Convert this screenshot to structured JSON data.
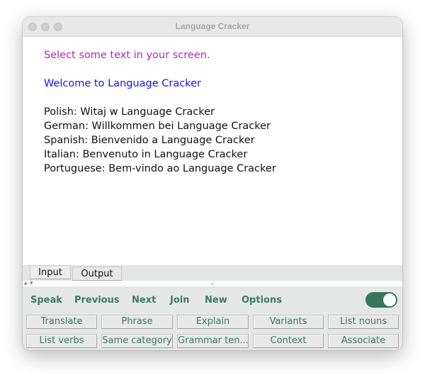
{
  "window": {
    "title": "Language Cracker",
    "traffic_lights": [
      "close",
      "minimize",
      "zoom"
    ]
  },
  "content": {
    "prompt": "Select some text in your screen.",
    "welcome": "Welcome to Language Cracker",
    "translations": [
      "Polish: Witaj w Language Cracker",
      "German: Willkommen bei Language Cracker",
      "Spanish: Bienvenido a Language Cracker",
      "Italian: Benvenuto in Language Cracker",
      "Portuguese: Bem-vindo ao Language Cracker"
    ],
    "colors": {
      "prompt": "#b126bd",
      "welcome": "#1414e6",
      "text": "#111111"
    }
  },
  "tabs": [
    {
      "label": "Input",
      "selected": true
    },
    {
      "label": "Output",
      "selected": false
    }
  ],
  "splitter": {
    "up_icon": "triangle-up-icon",
    "down_icon": "triangle-down-icon"
  },
  "actions": [
    {
      "label": "Speak"
    },
    {
      "label": "Previous"
    },
    {
      "label": "Next"
    },
    {
      "label": "Join"
    },
    {
      "label": "New"
    },
    {
      "label": "Options"
    }
  ],
  "toggle": {
    "on": true,
    "color": "#37775f"
  },
  "buttons": [
    [
      "Translate",
      "Phrase",
      "Explain",
      "Variants",
      "List nouns"
    ],
    [
      "List verbs",
      "Same category",
      "Grammar ten...",
      "Context",
      "Associate"
    ]
  ],
  "accent_color": "#3a7a63"
}
